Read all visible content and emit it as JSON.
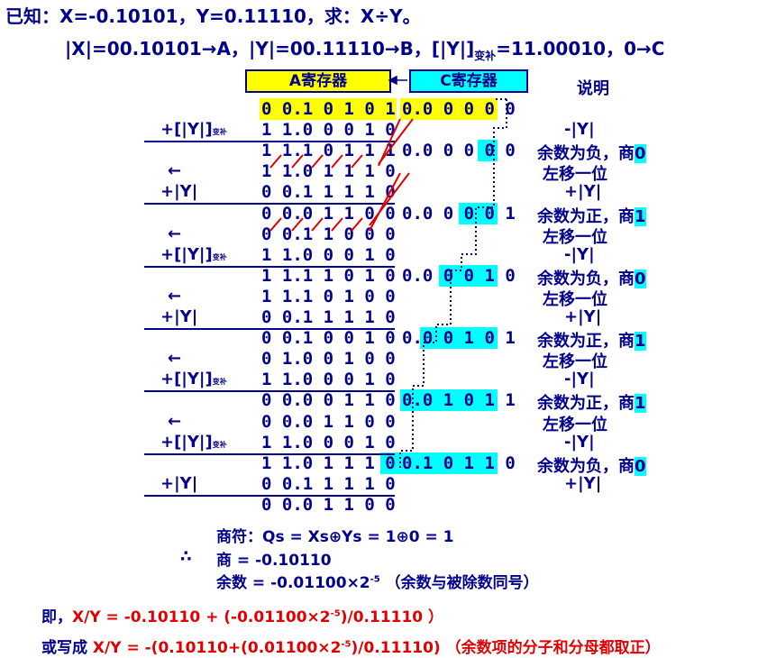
{
  "header": {
    "line1": "已知：X=-0.10101，Y=0.11110，求：X÷Y。",
    "line2_a": "|X|=00.10101→A，|Y|=00.11110→B，[|Y|]",
    "line2_sub": "变补",
    "line2_b": "=11.00010，0→C"
  },
  "registers": {
    "a": "A寄存器",
    "c": "C寄存器",
    "explain": "说明"
  },
  "a_rows": [
    "0 0.1 0 1 0 1",
    "1 1.0 0 0 1 0",
    "1 1.1 0 1 1 1",
    "1 1.0 1 1 1 0",
    "0 0.1 1 1 1 0",
    "0 0.0 1 1 0 0",
    "0 0.1 1 0 0 0",
    "1 1.0 0 0 1 0",
    "1 1.1 1 0 1 0",
    "1 1.1 0 1 0 0",
    "0 0.1 1 1 1 0",
    "0 0.1 0 0 1 0",
    "0 1.0 0 1 0 0",
    "1 1.0 0 0 1 0",
    "0 0.0 0 1 1 0",
    "0 0.0 1 1 0 0",
    "1 1.0 0 0 1 0",
    "1 1.0 1 1 1 0",
    "0 0.1 1 1 1 0",
    "0 0.0 1 1 0 0"
  ],
  "ops": [
    {
      "row": 1,
      "text": "+[|Y|]",
      "sub": "变补"
    },
    {
      "row": 3,
      "text": "←",
      "sub": ""
    },
    {
      "row": 4,
      "text": "+|Y|",
      "sub": ""
    },
    {
      "row": 6,
      "text": "←",
      "sub": ""
    },
    {
      "row": 7,
      "text": "+[|Y|]",
      "sub": "变补"
    },
    {
      "row": 9,
      "text": "←",
      "sub": ""
    },
    {
      "row": 10,
      "text": "+|Y|",
      "sub": ""
    },
    {
      "row": 12,
      "text": "←",
      "sub": ""
    },
    {
      "row": 13,
      "text": "+[|Y|]",
      "sub": "变补"
    },
    {
      "row": 15,
      "text": "←",
      "sub": ""
    },
    {
      "row": 16,
      "text": "+[|Y|]",
      "sub": "变补"
    },
    {
      "row": 18,
      "text": "+|Y|",
      "sub": ""
    }
  ],
  "c_rows": [
    {
      "row": 0,
      "text": "0.0 0 0 0 0"
    },
    {
      "row": 2,
      "text": "0.0 0 0 0 0"
    },
    {
      "row": 5,
      "text": "0.0 0 0 0 1"
    },
    {
      "row": 8,
      "text": "0.0 0 0 1 0"
    },
    {
      "row": 11,
      "text": "0.0 0 1 0 1"
    },
    {
      "row": 14,
      "text": "0.0 1 0 1 1"
    },
    {
      "row": 17,
      "text": "0.1 0 1 1 0"
    }
  ],
  "notes": [
    {
      "row": 1,
      "text": "-|Y|",
      "digit": ""
    },
    {
      "row": 2,
      "text": "余数为负，商",
      "digit": "0"
    },
    {
      "row": 3,
      "text": "左移一位",
      "digit": ""
    },
    {
      "row": 4,
      "text": "+|Y|",
      "digit": ""
    },
    {
      "row": 5,
      "text": "余数为正，商",
      "digit": "1"
    },
    {
      "row": 6,
      "text": "左移一位",
      "digit": ""
    },
    {
      "row": 7,
      "text": "-|Y|",
      "digit": ""
    },
    {
      "row": 8,
      "text": "余数为负，商",
      "digit": "0"
    },
    {
      "row": 9,
      "text": "左移一位",
      "digit": ""
    },
    {
      "row": 10,
      "text": "+|Y|",
      "digit": ""
    },
    {
      "row": 11,
      "text": "余数为正，商",
      "digit": "1"
    },
    {
      "row": 12,
      "text": "左移一位",
      "digit": ""
    },
    {
      "row": 13,
      "text": "-|Y|",
      "digit": ""
    },
    {
      "row": 14,
      "text": "余数为正，商",
      "digit": "1"
    },
    {
      "row": 15,
      "text": "左移一位",
      "digit": ""
    },
    {
      "row": 16,
      "text": "-|Y|",
      "digit": ""
    },
    {
      "row": 17,
      "text": "余数为负，商",
      "digit": "0"
    },
    {
      "row": 18,
      "text": "+|Y|",
      "digit": ""
    }
  ],
  "result": {
    "sign_line": "商符：Qs =  Xs⊕Ys = 1⊕0 = 1",
    "therefore": "∴",
    "quotient": "商 = -0.10110",
    "remainder_a": "余数 = -0.01100×2",
    "remainder_exp": "-5",
    "remainder_b": " （余数与被除数同号）"
  },
  "footer": {
    "line1_prefix": "即，",
    "line1_red": "X/Y = -0.10110 + (-0.01100×2",
    "line1_exp": "-5",
    "line1_tail": ")/0.11110 ）",
    "line2_prefix": "或写成 ",
    "line2_red": "X/Y = -(0.10110+(0.01100×2",
    "line2_exp": "-5",
    "line2_tail": ")/0.11110) （余数项的分子和分母都取正）"
  },
  "colors": {
    "text": "#00008B",
    "highlight_a": "#FFFF00",
    "highlight_c": "#00FFFF",
    "arrow": "#E00000"
  }
}
